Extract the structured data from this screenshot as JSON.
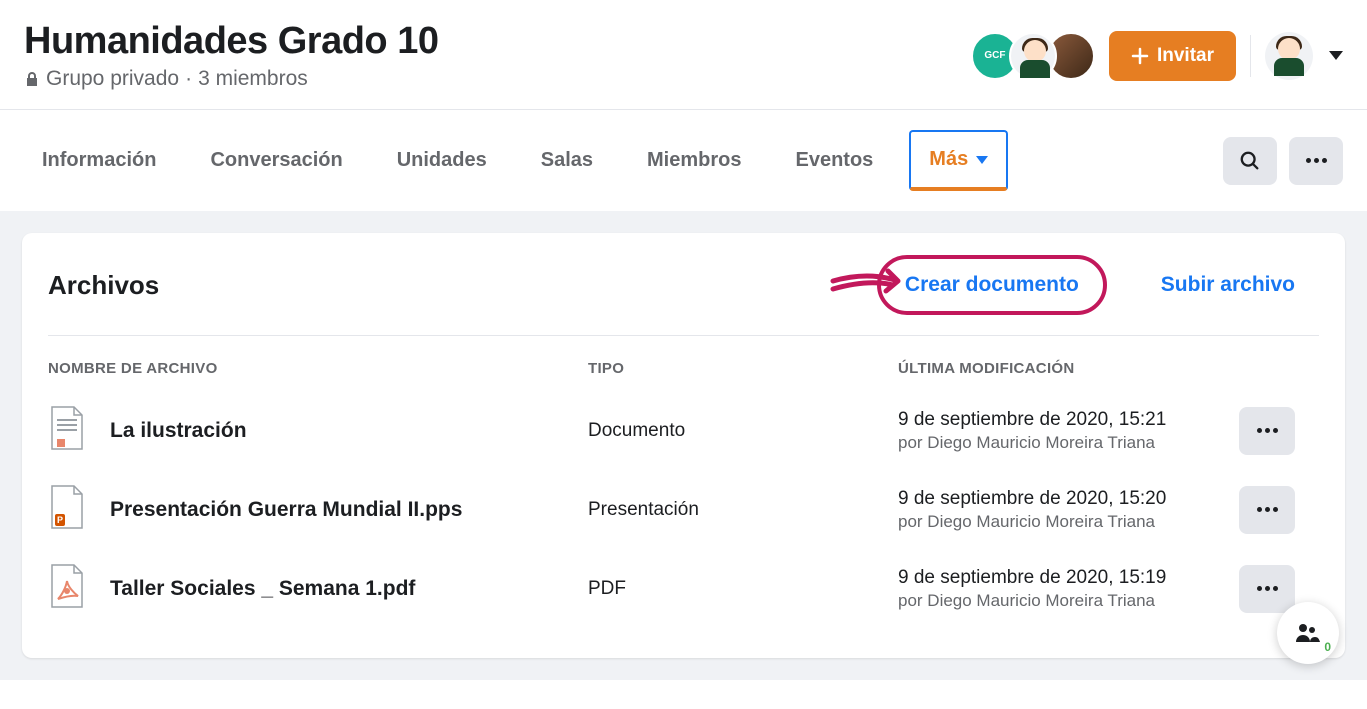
{
  "header": {
    "title": "Humanidades Grado 10",
    "privacy": "Grupo privado",
    "members": "3 miembros",
    "invite_label": "Invitar"
  },
  "nav": {
    "tabs": [
      "Información",
      "Conversación",
      "Unidades",
      "Salas",
      "Miembros",
      "Eventos",
      "Más"
    ]
  },
  "files": {
    "section_title": "Archivos",
    "create_doc": "Crear documento",
    "upload": "Subir archivo",
    "columns": {
      "name": "NOMBRE DE ARCHIVO",
      "type": "TIPO",
      "modified": "ÚLTIMA MODIFICACIÓN"
    },
    "rows": [
      {
        "name": "La ilustración",
        "type": "Documento",
        "date": "9 de septiembre de 2020, 15:21",
        "author": "por Diego Mauricio Moreira Triana",
        "icon": "doc"
      },
      {
        "name": "Presentación Guerra Mundial II.pps",
        "type": "Presentación",
        "date": "9 de septiembre de 2020, 15:20",
        "author": "por Diego Mauricio Moreira Triana",
        "icon": "pps"
      },
      {
        "name": "Taller Sociales _ Semana 1.pdf",
        "type": "PDF",
        "date": "9 de septiembre de 2020, 15:19",
        "author": "por Diego Mauricio Moreira Triana",
        "icon": "pdf"
      }
    ]
  },
  "float": {
    "count": "0"
  }
}
